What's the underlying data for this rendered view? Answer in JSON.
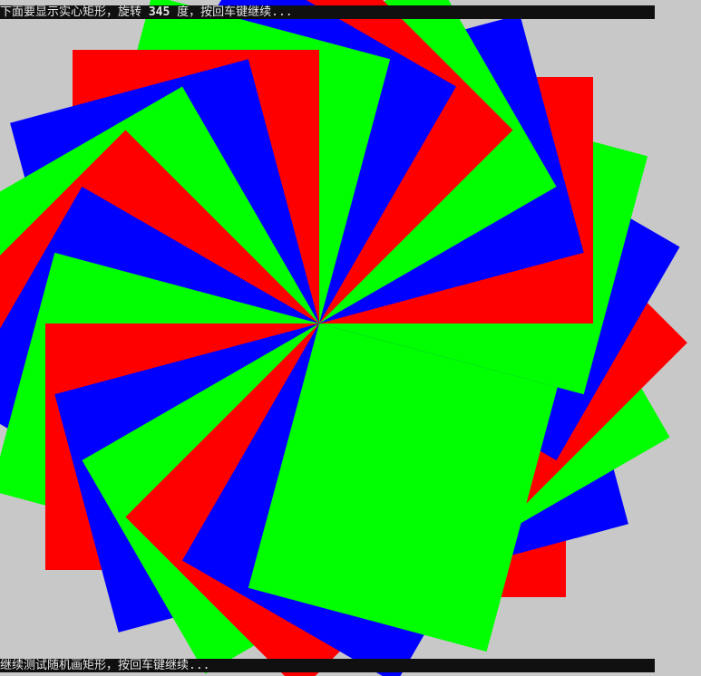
{
  "console": {
    "top_prefix": "下面要显示实心矩形，旋转 ",
    "top_angle": "345",
    "top_suffix": " 度，按回车键继续...",
    "bottom": "继续测试随机画矩形，按回车键继续..."
  },
  "colors": {
    "background": "#c8c8c8",
    "red": "#ff0000",
    "green": "#00ff00",
    "blue": "#0000ff",
    "console_bg": "#101010",
    "console_text": "#e6e6e6"
  },
  "rotation_step_deg": 15,
  "final_angle_deg": 345,
  "fill_order": [
    "red",
    "blue",
    "green"
  ]
}
